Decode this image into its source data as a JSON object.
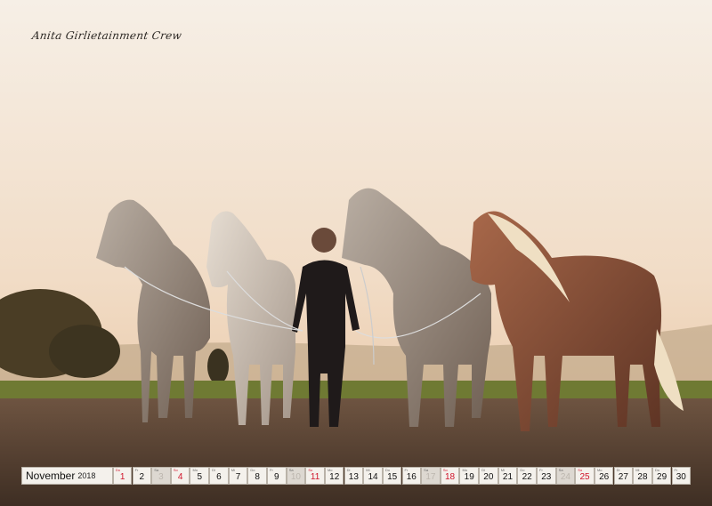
{
  "photo": {
    "description_icon": "horses-and-rider-photo"
  },
  "signature": "Anita Girlietainment Crew",
  "calendar": {
    "month": "November",
    "year": "2018",
    "days": [
      {
        "num": "1",
        "wd": "Do",
        "type": "holiday"
      },
      {
        "num": "2",
        "wd": "Fr",
        "type": "normal"
      },
      {
        "num": "3",
        "wd": "Sa",
        "type": "sunday"
      },
      {
        "num": "4",
        "wd": "So",
        "type": "holiday"
      },
      {
        "num": "5",
        "wd": "Mo",
        "type": "normal"
      },
      {
        "num": "6",
        "wd": "Di",
        "type": "normal"
      },
      {
        "num": "7",
        "wd": "Mi",
        "type": "normal"
      },
      {
        "num": "8",
        "wd": "Do",
        "type": "normal"
      },
      {
        "num": "9",
        "wd": "Fr",
        "type": "normal"
      },
      {
        "num": "10",
        "wd": "Sa",
        "type": "sunday"
      },
      {
        "num": "11",
        "wd": "So",
        "type": "holiday"
      },
      {
        "num": "12",
        "wd": "Mo",
        "type": "normal"
      },
      {
        "num": "13",
        "wd": "Di",
        "type": "normal"
      },
      {
        "num": "14",
        "wd": "Mi",
        "type": "normal"
      },
      {
        "num": "15",
        "wd": "Do",
        "type": "normal"
      },
      {
        "num": "16",
        "wd": "Fr",
        "type": "normal"
      },
      {
        "num": "17",
        "wd": "Sa",
        "type": "sunday"
      },
      {
        "num": "18",
        "wd": "So",
        "type": "holiday"
      },
      {
        "num": "19",
        "wd": "Mo",
        "type": "normal"
      },
      {
        "num": "20",
        "wd": "Di",
        "type": "normal"
      },
      {
        "num": "21",
        "wd": "Mi",
        "type": "normal"
      },
      {
        "num": "22",
        "wd": "Do",
        "type": "normal"
      },
      {
        "num": "23",
        "wd": "Fr",
        "type": "normal"
      },
      {
        "num": "24",
        "wd": "Sa",
        "type": "sunday"
      },
      {
        "num": "25",
        "wd": "So",
        "type": "holiday"
      },
      {
        "num": "26",
        "wd": "Mo",
        "type": "normal"
      },
      {
        "num": "27",
        "wd": "Di",
        "type": "normal"
      },
      {
        "num": "28",
        "wd": "Mi",
        "type": "normal"
      },
      {
        "num": "29",
        "wd": "Do",
        "type": "normal"
      },
      {
        "num": "30",
        "wd": "Fr",
        "type": "normal"
      }
    ]
  },
  "colors": {
    "sky_top": "#f7eee4",
    "sky_bottom": "#efd2b2",
    "ground": "#5a4536",
    "holiday": "#d0142b"
  }
}
